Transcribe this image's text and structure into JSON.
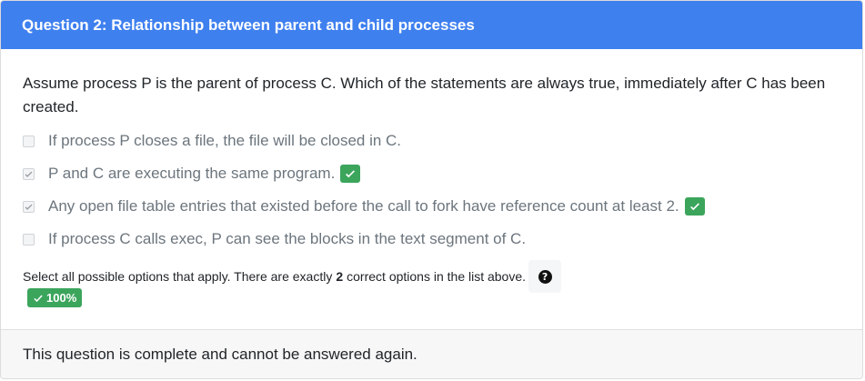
{
  "header": {
    "title": "Question 2: Relationship between parent and child processes"
  },
  "question": {
    "text": "Assume process P is the parent of process C. Which of the statements are always true, immediately after C has been created."
  },
  "options": [
    {
      "label": "If process P closes a file, the file will be closed in C.",
      "checked": false,
      "correct": false
    },
    {
      "label": "P and C are executing the same program.",
      "checked": true,
      "correct": true
    },
    {
      "label": "Any open file table entries that existed before the call to fork have reference count at least 2.",
      "checked": true,
      "correct": true
    },
    {
      "label": "If process C calls exec, P can see the blocks in the text segment of C.",
      "checked": false,
      "correct": false
    }
  ],
  "hint": {
    "prefix": "Select all possible options that apply. There are exactly",
    "count": "2",
    "suffix": "correct options in the list above.",
    "help_icon": "?"
  },
  "score": {
    "label": "100%"
  },
  "footer": {
    "text": "This question is complete and cannot be answered again."
  },
  "colors": {
    "header_bg": "#3f80ef",
    "success": "#3ba55c",
    "muted_text": "#6c757d"
  }
}
